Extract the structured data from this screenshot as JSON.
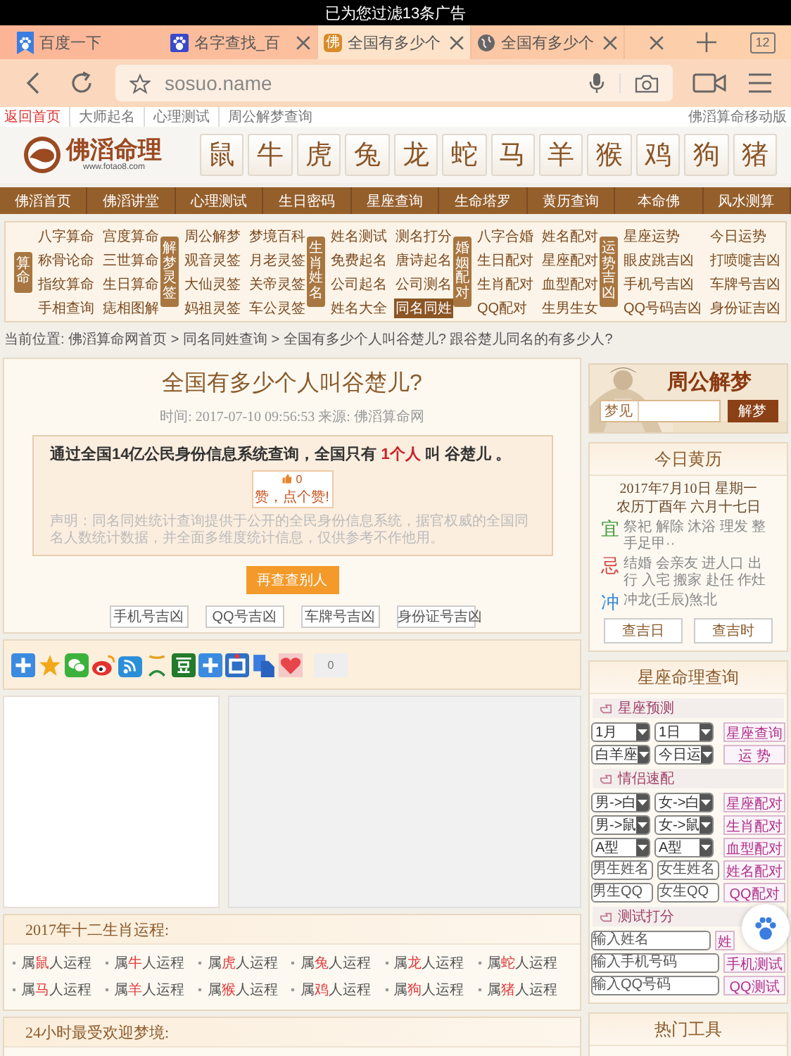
{
  "status_bar": {
    "text": "已为您过滤13条广告"
  },
  "browser": {
    "tabs": [
      {
        "title": "百度一下",
        "closable": false,
        "selected": false
      },
      {
        "title": "名字查找_百",
        "closable": true,
        "selected": false
      },
      {
        "title": "全国有多少个",
        "icon_char": "佛",
        "closable": true,
        "selected": true
      },
      {
        "title": "全国有多少个",
        "closable": true,
        "selected": false
      }
    ],
    "tab_count": "12",
    "address": "sosuo.name"
  },
  "site": {
    "top_links": [
      {
        "label": "返回首页",
        "selected": true
      },
      {
        "label": "大师起名",
        "selected": false
      },
      {
        "label": "心理测试",
        "selected": false
      },
      {
        "label": "周公解梦查询",
        "selected": false
      }
    ],
    "mobile_link": "佛滔算命移动版",
    "logo": {
      "name": "佛滔命理",
      "url": "www.fotao8.com"
    },
    "zodiac": [
      "鼠",
      "牛",
      "虎",
      "兔",
      "龙",
      "蛇",
      "马",
      "羊",
      "猴",
      "鸡",
      "狗",
      "猪"
    ],
    "nav": [
      "佛滔首页",
      "佛滔讲堂",
      "心理测试",
      "生日密码",
      "星座查询",
      "生命塔罗",
      "黄历查询",
      "本命佛",
      "风水测算"
    ],
    "menu_groups": [
      {
        "label": "算命",
        "links": [
          {
            "label": "八字算命",
            "selected": false
          },
          {
            "label": "宫度算命",
            "selected": false
          },
          {
            "label": "称骨论命",
            "selected": false
          },
          {
            "label": "三世算命",
            "selected": false
          },
          {
            "label": "指纹算命",
            "selected": false
          },
          {
            "label": "生日算命",
            "selected": false
          },
          {
            "label": "手相查询",
            "selected": false
          },
          {
            "label": "痣相图解",
            "selected": false
          }
        ]
      },
      {
        "label": "解梦灵签",
        "links": [
          {
            "label": "周公解梦",
            "selected": false
          },
          {
            "label": "梦境百科",
            "selected": false
          },
          {
            "label": "观音灵签",
            "selected": false
          },
          {
            "label": "月老灵签",
            "selected": false
          },
          {
            "label": "大仙灵签",
            "selected": false
          },
          {
            "label": "关帝灵签",
            "selected": false
          },
          {
            "label": "妈祖灵签",
            "selected": false
          },
          {
            "label": "车公灵签",
            "selected": false
          }
        ]
      },
      {
        "label": "生肖姓名",
        "links": [
          {
            "label": "姓名测试",
            "selected": false
          },
          {
            "label": "测名打分",
            "selected": false
          },
          {
            "label": "免费起名",
            "selected": false
          },
          {
            "label": "唐诗起名",
            "selected": false
          },
          {
            "label": "公司起名",
            "selected": false
          },
          {
            "label": "公司测名",
            "selected": false
          },
          {
            "label": "姓名大全",
            "selected": false
          },
          {
            "label": "同名同姓",
            "selected": true
          }
        ]
      },
      {
        "label": "婚姻配对",
        "links": [
          {
            "label": "八字合婚",
            "selected": false
          },
          {
            "label": "姓名配对",
            "selected": false
          },
          {
            "label": "生日配对",
            "selected": false
          },
          {
            "label": "星座配对",
            "selected": false
          },
          {
            "label": "生肖配对",
            "selected": false
          },
          {
            "label": "血型配对",
            "selected": false
          },
          {
            "label": "QQ配对",
            "selected": false
          },
          {
            "label": "生男生女",
            "selected": false
          }
        ]
      },
      {
        "label": "运势吉凶",
        "links": [
          {
            "label": "星座运势",
            "selected": false
          },
          {
            "label": "今日运势",
            "selected": false
          },
          {
            "label": "眼皮跳吉凶",
            "selected": false
          },
          {
            "label": "打喷嚏吉凶",
            "selected": false
          },
          {
            "label": "手机号吉凶",
            "selected": false
          },
          {
            "label": "车牌号吉凶",
            "selected": false
          },
          {
            "label": "QQ号码吉凶",
            "selected": false
          },
          {
            "label": "身份证吉凶",
            "selected": false
          }
        ]
      }
    ],
    "breadcrumb": "当前位置: 佛滔算命网首页 > 同名同姓查询 > 全国有多少个人叫谷楚儿? 跟谷楚儿同名的有多少人?"
  },
  "article": {
    "title": "全国有多少个人叫谷楚儿?",
    "meta": "时间: 2017-07-10 09:56:53  来源: 佛滔算命网",
    "result": {
      "before": "通过全国14亿公民身份信息系统查询，全国只有 ",
      "count": "1个人",
      "middle": " 叫 ",
      "name": "谷楚儿",
      "after": " 。"
    },
    "like": {
      "count": "0",
      "label": "赞，点个赞!"
    },
    "disclaimer": "声明：同名同姓统计查询提供于公开的全民身份信息系统，据官权威的全国同名人数统计数据，并全面多维度统计信息，仅供参考不作他用。",
    "again_button": "再查查别人",
    "tool_buttons": [
      "手机号吉凶",
      "QQ号吉凶",
      "车牌号吉凶",
      "身份证号吉凶"
    ]
  },
  "share": {
    "count": "0"
  },
  "fortunes": {
    "title": "2017年十二生肖运程:",
    "items": [
      {
        "before": "属",
        "animal": "鼠",
        "after": "人运程"
      },
      {
        "before": "属",
        "animal": "牛",
        "after": "人运程"
      },
      {
        "before": "属",
        "animal": "虎",
        "after": "人运程"
      },
      {
        "before": "属",
        "animal": "兔",
        "after": "人运程"
      },
      {
        "before": "属",
        "animal": "龙",
        "after": "人运程"
      },
      {
        "before": "属",
        "animal": "蛇",
        "after": "人运程"
      },
      {
        "before": "属",
        "animal": "马",
        "after": "人运程"
      },
      {
        "before": "属",
        "animal": "羊",
        "after": "人运程"
      },
      {
        "before": "属",
        "animal": "猴",
        "after": "人运程"
      },
      {
        "before": "属",
        "animal": "鸡",
        "after": "人运程"
      },
      {
        "before": "属",
        "animal": "狗",
        "after": "人运程"
      },
      {
        "before": "属",
        "animal": "猪",
        "after": "人运程"
      }
    ]
  },
  "dreams": {
    "title": "24小时最受欢迎梦境:"
  },
  "dream_search": {
    "title": "周公解梦",
    "field_label": "梦见",
    "button": "解梦"
  },
  "almanac": {
    "title": "今日黄历",
    "date": "2017年7月10日 星期一",
    "lunar": "农历丁酉年 六月十七日",
    "rows": [
      {
        "sign": "宜",
        "text": "祭祀 解除 沐浴 理发 整手足甲··",
        "color": "#3f9b3a"
      },
      {
        "sign": "忌",
        "text": "结婚 会亲友 进人口 出行 入宅 搬家 赴任 作灶",
        "color": "#d2433f"
      },
      {
        "sign": "冲",
        "text": "冲龙(壬辰)煞北",
        "color": "#3a86d6"
      }
    ],
    "buttons": [
      "查吉日",
      "查吉时"
    ]
  },
  "horoscope": {
    "title": "星座命理查询",
    "sections": [
      {
        "title": "星座预测",
        "rows": [
          {
            "kind": "select",
            "fields": [
              {
                "value": "1月"
              },
              {
                "value": "1日"
              }
            ],
            "button": "星座查询"
          },
          {
            "kind": "select",
            "fields": [
              {
                "value": "白羊座"
              },
              {
                "value": "今日运"
              }
            ],
            "button": "运 势"
          }
        ]
      },
      {
        "title": "情侣速配",
        "rows": [
          {
            "kind": "select",
            "fields": [
              {
                "value": "男->白"
              },
              {
                "value": "女->白"
              }
            ],
            "button": "星座配对"
          },
          {
            "kind": "select",
            "fields": [
              {
                "value": "男->鼠"
              },
              {
                "value": "女->鼠"
              }
            ],
            "button": "生肖配对"
          },
          {
            "kind": "select",
            "fields": [
              {
                "value": "A型"
              },
              {
                "value": "A型"
              }
            ],
            "button": "血型配对"
          },
          {
            "kind": "input",
            "fields": [
              {
                "placeholder": "男生姓名"
              },
              {
                "placeholder": "女生姓名"
              }
            ],
            "button": "姓名配对"
          },
          {
            "kind": "input",
            "fields": [
              {
                "placeholder": "男生QQ"
              },
              {
                "placeholder": "女生QQ"
              }
            ],
            "button": "QQ配对"
          }
        ]
      },
      {
        "title": "测试打分",
        "rows": [
          {
            "kind": "input",
            "fields": [
              {
                "placeholder": "输入姓名"
              }
            ],
            "button": "姓"
          },
          {
            "kind": "input",
            "fields": [
              {
                "placeholder": "输入手机号码"
              }
            ],
            "button": "手机测试"
          },
          {
            "kind": "input",
            "fields": [
              {
                "placeholder": "输入QQ号码"
              }
            ],
            "button": "QQ测试"
          }
        ]
      }
    ]
  },
  "hot_tools": {
    "title": "热门工具"
  }
}
